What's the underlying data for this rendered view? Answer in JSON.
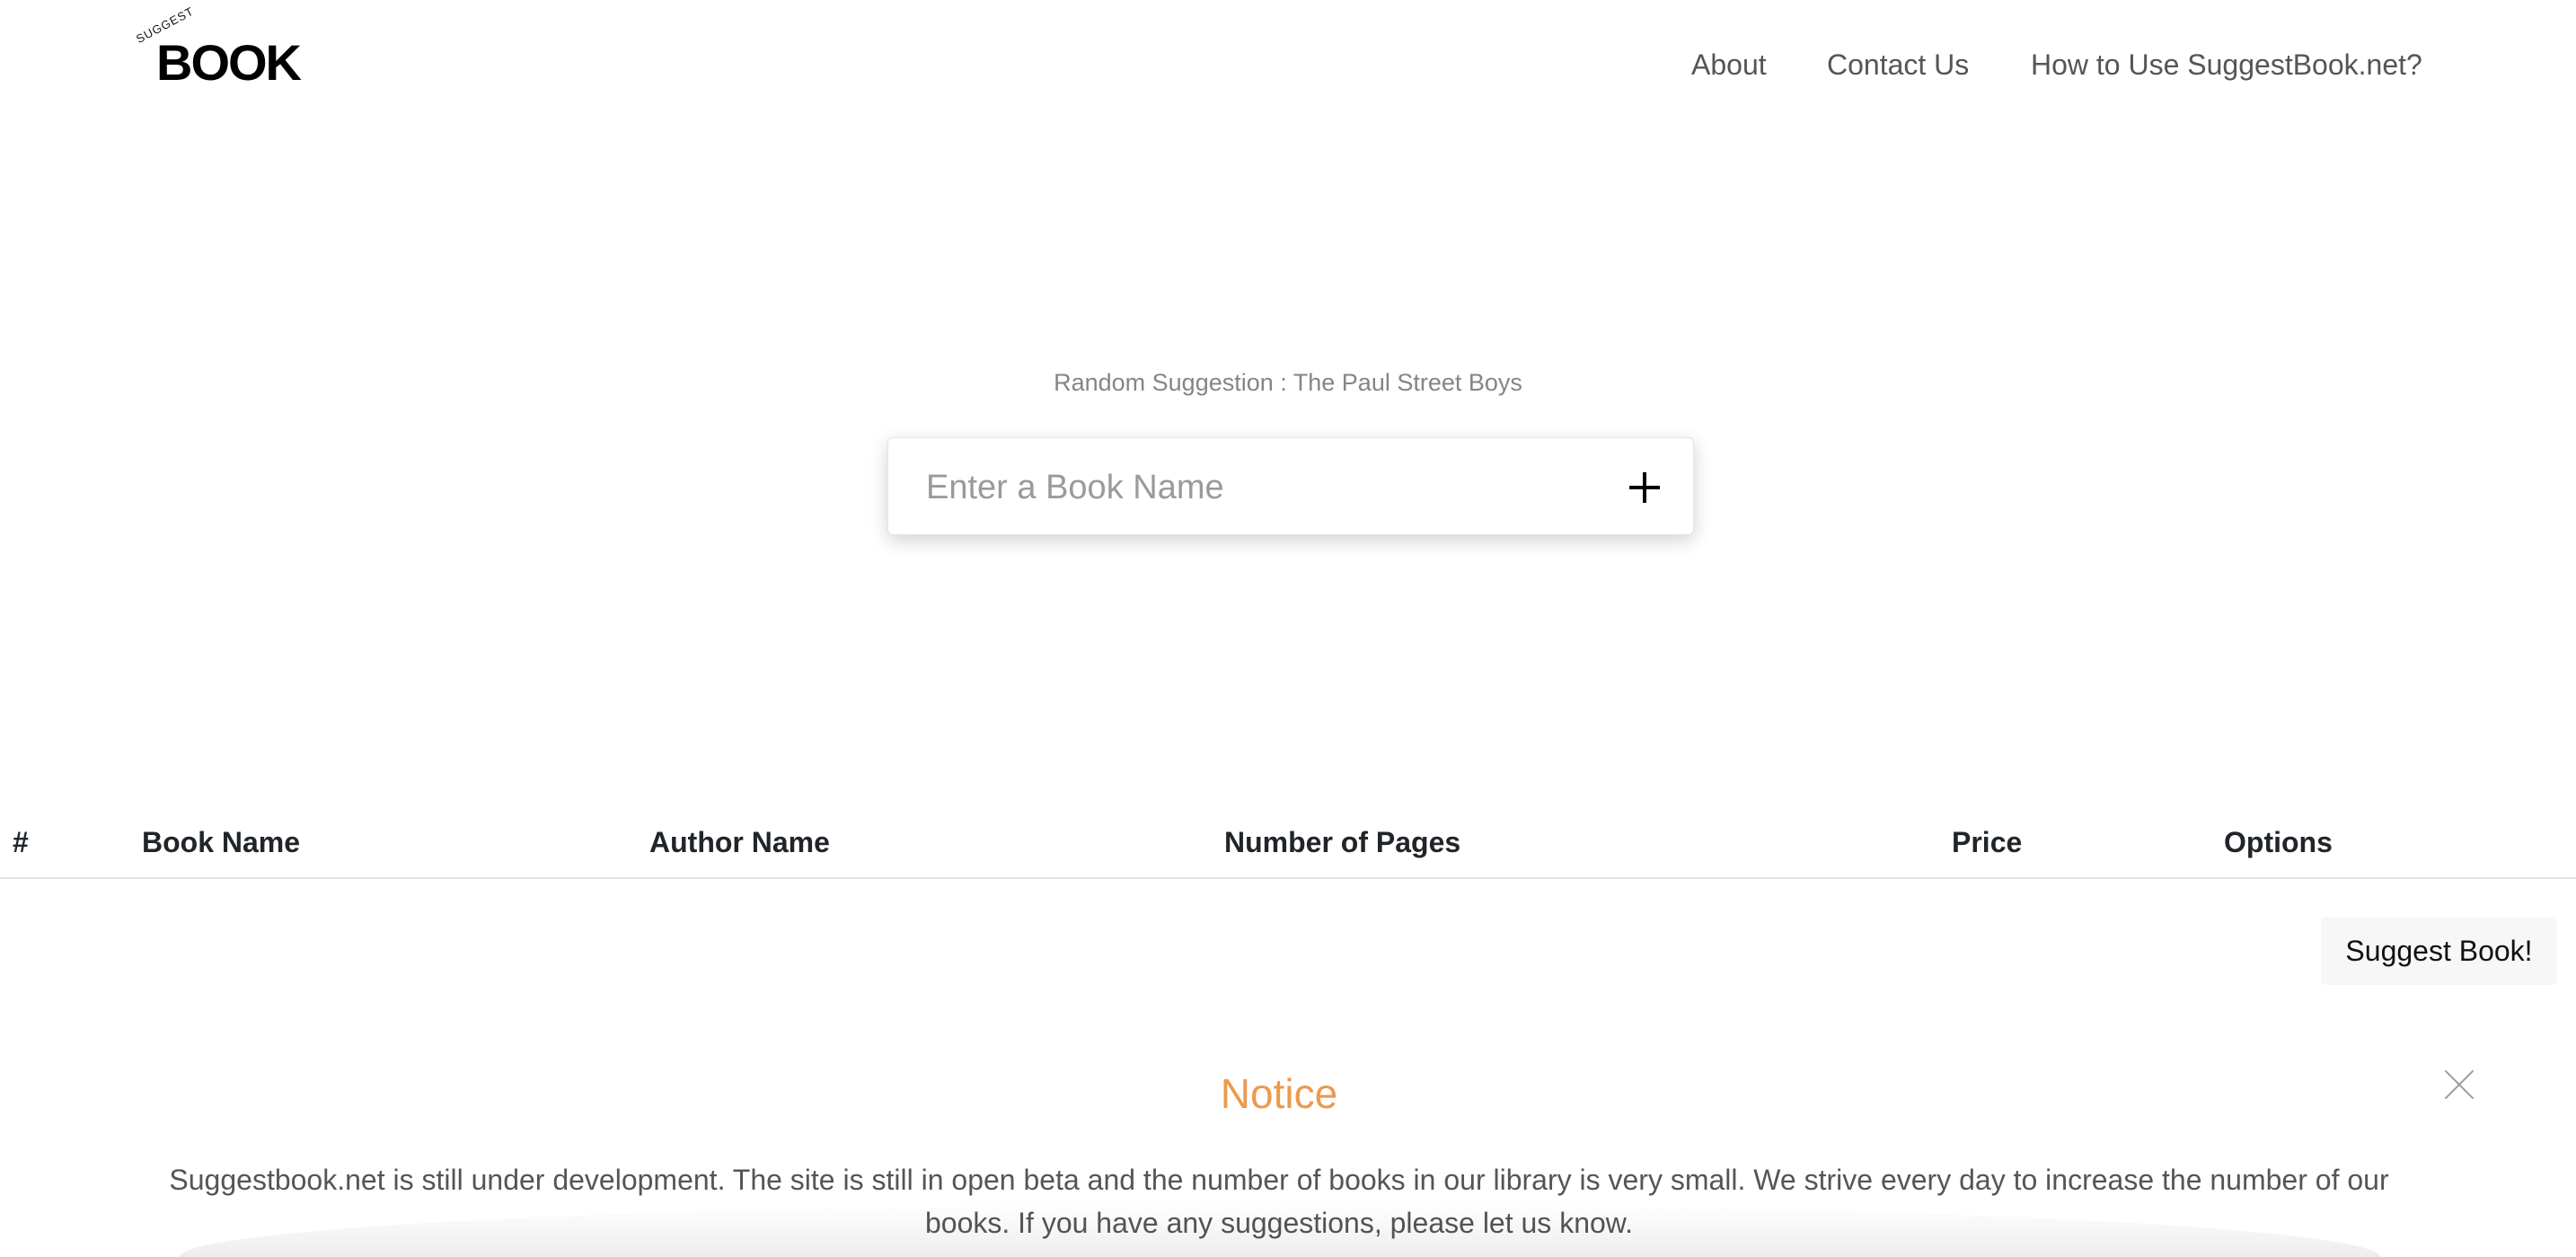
{
  "header": {
    "logo": {
      "small": "SUGGEST",
      "big": "BOOK"
    },
    "nav": {
      "about": "About",
      "contact": "Contact Us",
      "how": "How to Use SuggestBook.net?"
    }
  },
  "search": {
    "suggestion": "Random Suggestion : The Paul Street Boys",
    "placeholder": "Enter a Book Name",
    "add_icon": "plus-icon"
  },
  "table": {
    "columns": [
      "#",
      "Book Name",
      "Author Name",
      "Number of Pages",
      "Price",
      "Options"
    ],
    "rows": []
  },
  "suggest_button": "Suggest Book!",
  "notice": {
    "title": "Notice",
    "close_icon": "close-icon",
    "text": "Suggestbook.net is still under development. The site is still in open beta and the number of books in our library is very small. We strive every day to increase the number of our books. If you have any suggestions, please let us know."
  },
  "colors": {
    "accent": "#ec9a4f",
    "nav_text": "#555555",
    "muted": "#858585"
  }
}
